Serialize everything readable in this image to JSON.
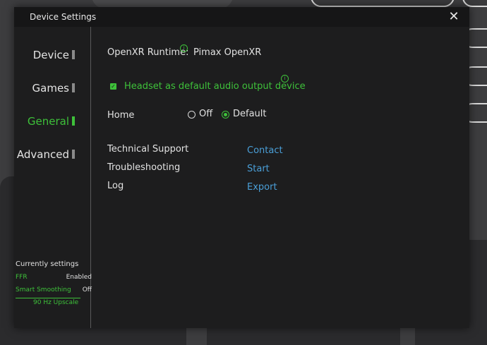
{
  "dialog": {
    "title": "Device Settings",
    "close_icon": "✕"
  },
  "sidebar": {
    "items": [
      {
        "label": "Device",
        "active": false
      },
      {
        "label": "Games",
        "active": false
      },
      {
        "label": "General",
        "active": true
      },
      {
        "label": "Advanced",
        "active": false
      }
    ]
  },
  "summary": {
    "heading": "Currently settings",
    "rows": [
      {
        "key": "FFR",
        "value": "Enabled"
      },
      {
        "key": "Smart Smoothing",
        "value": "Off"
      }
    ],
    "upscale": "90 Hz Upscale"
  },
  "general": {
    "runtime": {
      "label": "OpenXR Runtime:",
      "value": "Pimax OpenXR",
      "info_icon": "i"
    },
    "audio_default": {
      "label": "Headset as default audio output device",
      "checked": true,
      "info_icon": "i"
    },
    "home": {
      "label": "Home",
      "options": [
        {
          "label": "Off",
          "selected": false
        },
        {
          "label": "Default",
          "selected": true
        }
      ]
    },
    "links": [
      {
        "label": "Technical Support",
        "action": "Contact"
      },
      {
        "label": "Troubleshooting",
        "action": "Start"
      },
      {
        "label": "Log",
        "action": "Export"
      }
    ]
  },
  "colors": {
    "accent": "#3ec13a",
    "link": "#4a9fd8",
    "dialog_bg": "#1d1d1e"
  }
}
